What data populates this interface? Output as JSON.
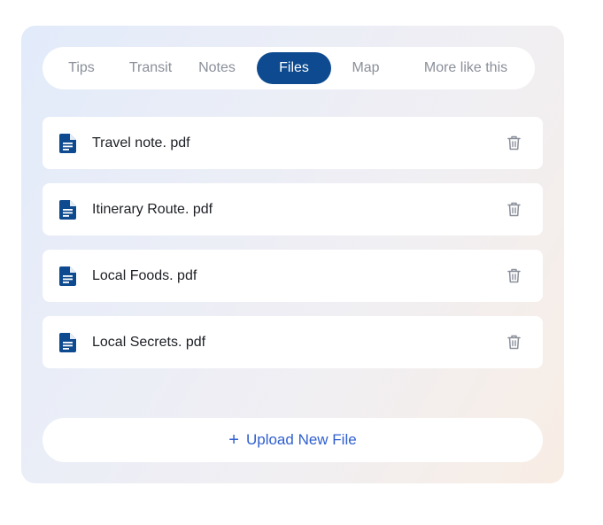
{
  "tabs": [
    {
      "label": "Tips",
      "active": false
    },
    {
      "label": "Transit",
      "active": false
    },
    {
      "label": "Notes",
      "active": false
    },
    {
      "label": "Files",
      "active": true
    },
    {
      "label": "Map",
      "active": false
    },
    {
      "label": "More like this",
      "active": false
    }
  ],
  "files": [
    {
      "name": "Travel note. pdf",
      "icon": "document-icon",
      "action_icon": "trash-icon"
    },
    {
      "name": "Itinerary Route. pdf",
      "icon": "document-icon",
      "action_icon": "trash-icon"
    },
    {
      "name": "Local Foods. pdf",
      "icon": "document-icon",
      "action_icon": "trash-icon"
    },
    {
      "name": "Local Secrets. pdf",
      "icon": "document-icon",
      "action_icon": "trash-icon"
    }
  ],
  "upload": {
    "icon": "plus",
    "label": "Upload New File"
  },
  "colors": {
    "accent": "#0d4a8f",
    "link": "#2f5fd0",
    "muted_text": "#8a8f99",
    "body_text": "#1c1f24"
  }
}
